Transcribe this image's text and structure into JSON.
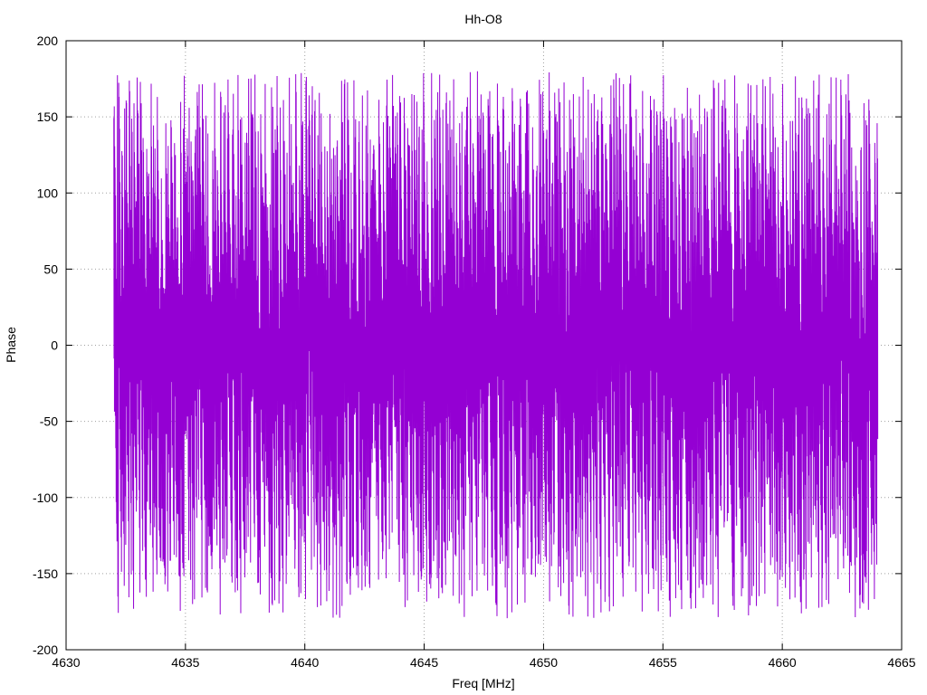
{
  "chart_data": {
    "type": "line",
    "title": "Hh-O8",
    "xlabel": "Freq [MHz]",
    "ylabel": "Phase",
    "xlim": [
      4630,
      4665
    ],
    "ylim": [
      -200,
      200
    ],
    "xticks": [
      4630,
      4635,
      4640,
      4645,
      4650,
      4655,
      4660,
      4665
    ],
    "yticks": [
      -200,
      -150,
      -100,
      -50,
      0,
      50,
      100,
      150,
      200
    ],
    "grid": true,
    "legend": "none",
    "series": [
      {
        "color": "#9400d3",
        "x_range": [
          4632,
          4664
        ],
        "y_range": [
          -180,
          180
        ],
        "description": "wrapped phase, rapidly oscillating across full range"
      }
    ]
  }
}
